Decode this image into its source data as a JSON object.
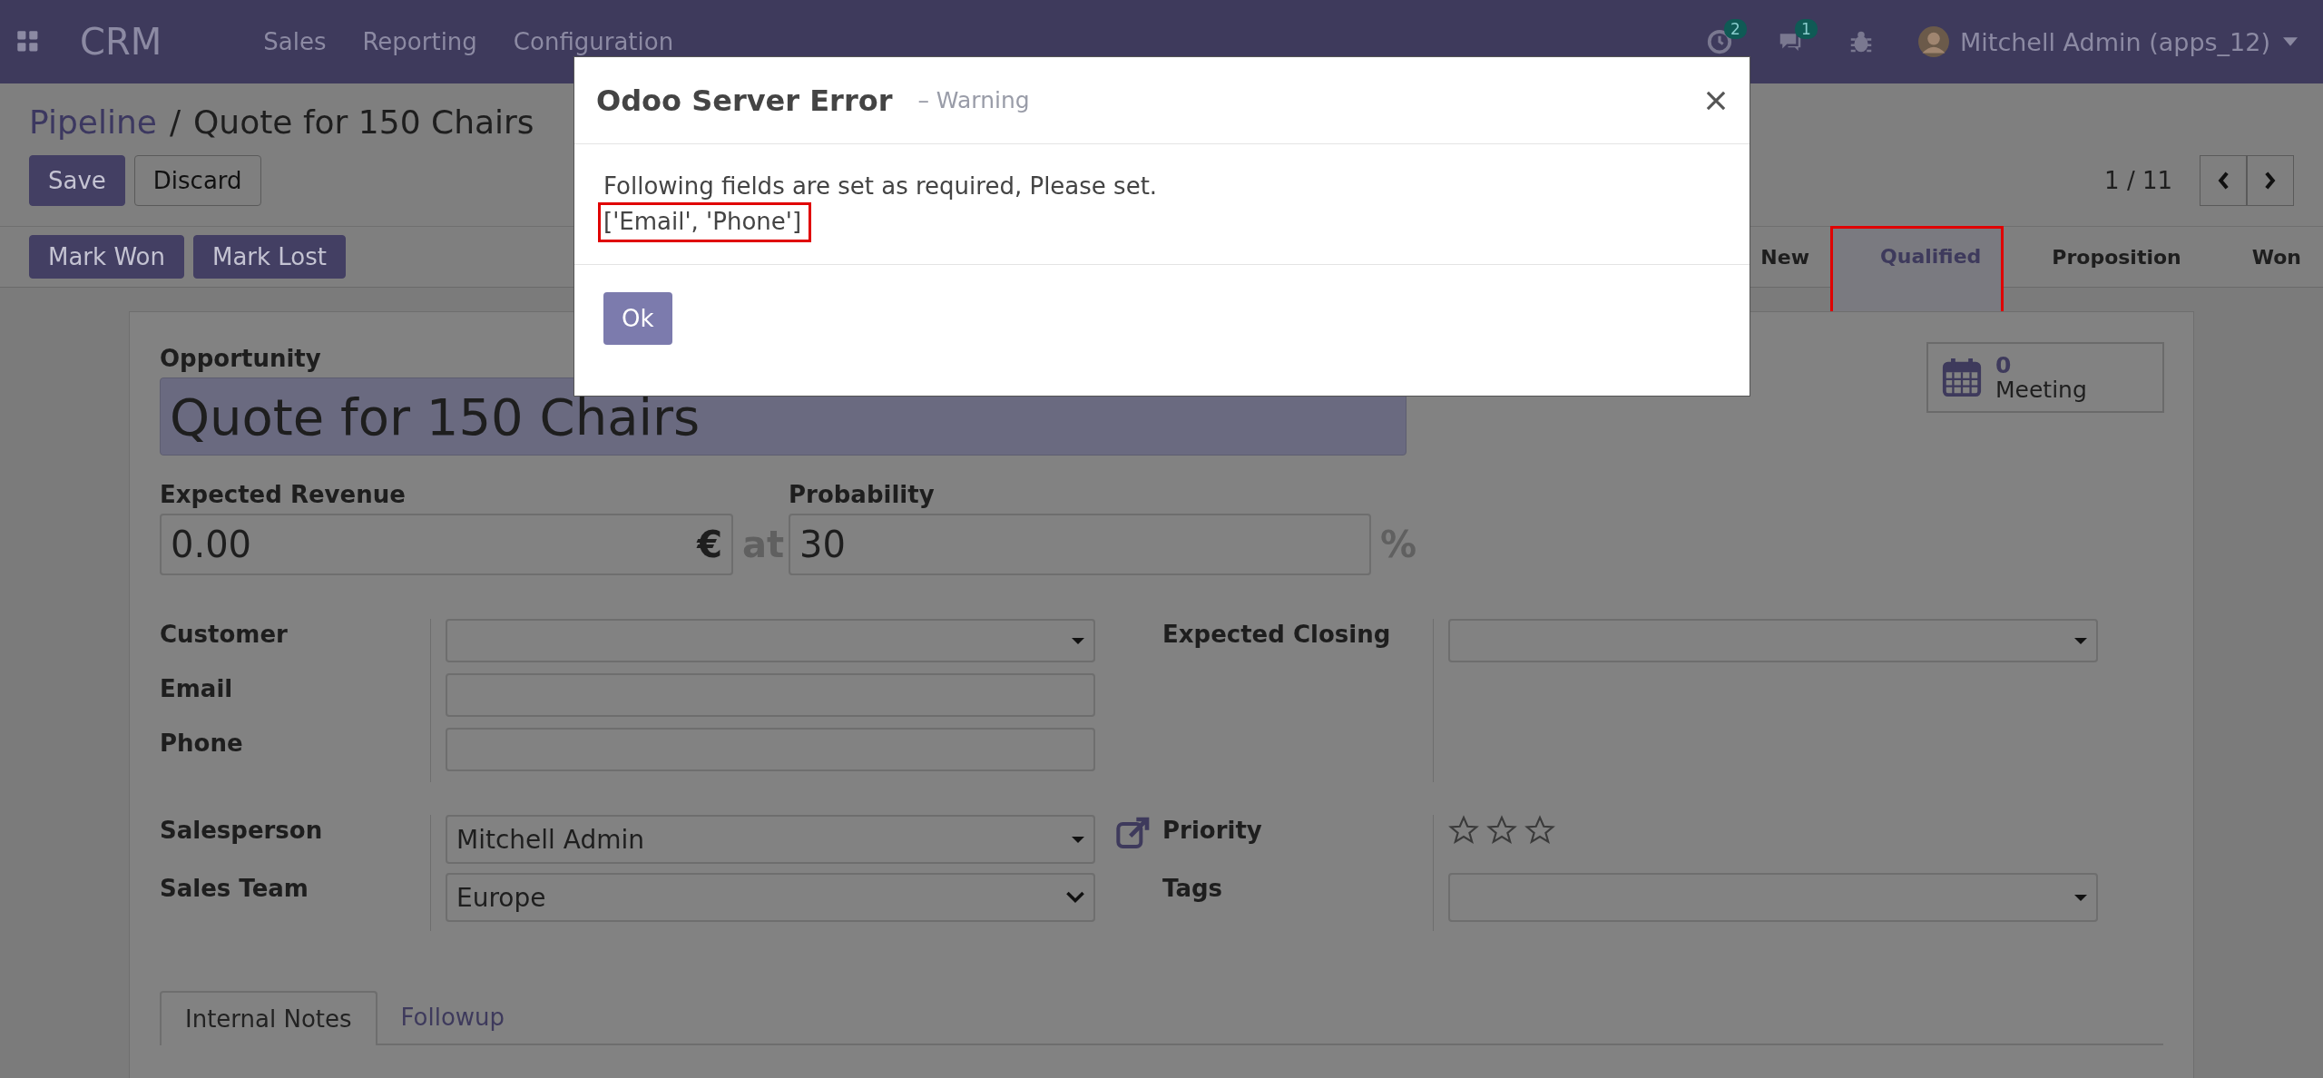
{
  "navbar": {
    "app_name": "CRM",
    "menus": [
      "Sales",
      "Reporting",
      "Configuration"
    ],
    "activity_count": "2",
    "message_count": "1",
    "user": "Mitchell Admin (apps_12)"
  },
  "breadcrumb": {
    "parent": "Pipeline",
    "separator": "/",
    "current": "Quote for 150 Chairs"
  },
  "actions": [
    "Save",
    "Discard"
  ],
  "pager": "1 / 11",
  "header_buttons": [
    "Mark Won",
    "Mark Lost"
  ],
  "stages": [
    {
      "label": "New",
      "selected": false,
      "highlighted": false
    },
    {
      "label": "Qualified",
      "selected": true,
      "highlighted": true
    },
    {
      "label": "Proposition",
      "selected": false,
      "highlighted": false
    },
    {
      "label": "Won",
      "selected": false,
      "highlighted": false
    }
  ],
  "meeting": {
    "count": "0",
    "label": "Meeting"
  },
  "opportunity": {
    "label": "Opportunity",
    "value": "Quote for 150 Chairs"
  },
  "revenue": {
    "label": "Expected Revenue",
    "value": "0.00",
    "currency": "€",
    "joiner": "at"
  },
  "probability": {
    "label": "Probability",
    "value": "30",
    "unit": "%"
  },
  "left_fields": [
    {
      "label": "Customer",
      "kind": "dropdown"
    },
    {
      "label": "Email",
      "kind": "text"
    },
    {
      "label": "Phone",
      "kind": "text"
    }
  ],
  "closing": {
    "label": "Expected Closing",
    "kind": "dropdown"
  },
  "team_fields": [
    {
      "label": "Salesperson",
      "value": "Mitchell Admin",
      "kind": "dropdown"
    },
    {
      "label": "Sales Team",
      "value": "Europe",
      "kind": "select"
    }
  ],
  "priority": {
    "label": "Priority",
    "stars": 0
  },
  "tags": {
    "label": "Tags"
  },
  "tabs": [
    {
      "label": "Internal Notes",
      "selected": true
    },
    {
      "label": "Followup",
      "selected": false
    }
  ],
  "dialog": {
    "title": "Odoo Server Error",
    "subtitle": "– Warning",
    "message": "Following fields are set as required, Please set.",
    "detail": "['Email', 'Phone']",
    "detail_highlighted": true,
    "button": "Ok"
  }
}
